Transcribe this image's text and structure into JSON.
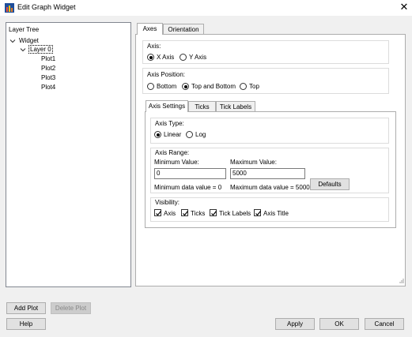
{
  "window": {
    "title": "Edit Graph Widget",
    "close_glyph": "✕"
  },
  "tree": {
    "header": "Layer Tree",
    "widget": "Widget",
    "layer": "Layer 0",
    "plots": [
      "Plot1",
      "Plot2",
      "Plot3",
      "Plot4"
    ]
  },
  "tabs": {
    "axes": "Axes",
    "orientation": "Orientation"
  },
  "axis_group": {
    "label": "Axis:",
    "x_axis": "X Axis",
    "y_axis": "Y Axis",
    "selected": "X Axis"
  },
  "axis_position": {
    "label": "Axis Position:",
    "bottom": "Bottom",
    "top_and_bottom": "Top and Bottom",
    "top": "Top",
    "selected": "Top and Bottom"
  },
  "subtabs": {
    "axis_settings": "Axis Settings",
    "ticks": "Ticks",
    "tick_labels": "Tick Labels"
  },
  "axis_type": {
    "label": "Axis Type:",
    "linear": "Linear",
    "log": "Log",
    "selected": "Linear"
  },
  "axis_range": {
    "label": "Axis Range:",
    "min_label": "Minimum Value:",
    "max_label": "Maximum Value:",
    "min_value": "0",
    "max_value": "5000",
    "min_data": "Minimum data value = 0",
    "max_data": "Maximum data value = 5000",
    "defaults": "Defaults"
  },
  "visibility": {
    "label": "Visibility:",
    "axis": "Axis",
    "ticks": "Ticks",
    "tick_labels": "Tick Labels",
    "axis_title": "Axis Title"
  },
  "buttons": {
    "add_plot": "Add Plot",
    "delete_plot": "Delete Plot",
    "help": "Help",
    "apply": "Apply",
    "ok": "OK",
    "cancel": "Cancel"
  },
  "colors": {
    "background": "#f0f0f0",
    "border": "#adadad",
    "icon_red": "#c0392b",
    "icon_blue": "#1f4e9c"
  }
}
